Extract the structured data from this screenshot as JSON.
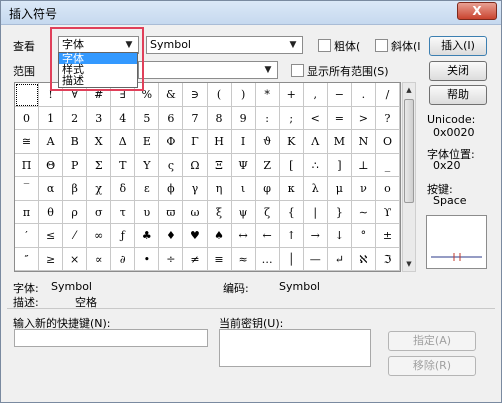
{
  "window": {
    "title": "插入符号",
    "close_label": "X"
  },
  "view": {
    "label": "查看",
    "combo_value": "字体",
    "dropdown_options": [
      "字体",
      "样式",
      "描述"
    ],
    "font_value": "Symbol"
  },
  "options": {
    "bold_label": "粗体(",
    "italic_label": "斜体(I",
    "range_label": "范围",
    "show_all_label": "显示所有范围(S)"
  },
  "buttons": {
    "insert": "插入(I)",
    "close": "关闭",
    "help": "帮助",
    "assign": "指定(A)",
    "remove": "移除(R)"
  },
  "info": {
    "unicode_label": "Unicode:",
    "unicode_value": "0x0020",
    "font_pos_label": "字体位置:",
    "font_pos_value": "0x20",
    "key_label": "按键:",
    "key_value": "Space"
  },
  "status": {
    "font_label": "字体:",
    "font_value": "Symbol",
    "code_label": "编码:",
    "code_value": "Symbol",
    "desc_label": "描述:",
    "desc_value": "空格"
  },
  "shortcut": {
    "new_label": "输入新的快捷键(N):",
    "current_label": "当前密钥(U):"
  },
  "symbols": [
    "",
    "!",
    "∀",
    "#",
    "∃",
    "%",
    "&",
    "∋",
    "(",
    ")",
    "*",
    "+",
    ",",
    "−",
    ".",
    "/",
    "0",
    "1",
    "2",
    "3",
    "4",
    "5",
    "6",
    "7",
    "8",
    "9",
    ":",
    ";",
    "<",
    "=",
    ">",
    "?",
    "≅",
    "Α",
    "Β",
    "Χ",
    "Δ",
    "Ε",
    "Φ",
    "Γ",
    "Η",
    "Ι",
    "ϑ",
    "Κ",
    "Λ",
    "Μ",
    "Ν",
    "Ο",
    "Π",
    "Θ",
    "Ρ",
    "Σ",
    "Τ",
    "Υ",
    "ς",
    "Ω",
    "Ξ",
    "Ψ",
    "Ζ",
    "[",
    "∴",
    "]",
    "⊥",
    "_",
    "‾",
    "α",
    "β",
    "χ",
    "δ",
    "ε",
    "ϕ",
    "γ",
    "η",
    "ι",
    "φ",
    "κ",
    "λ",
    "μ",
    "ν",
    "ο",
    "π",
    "θ",
    "ρ",
    "σ",
    "τ",
    "υ",
    "ϖ",
    "ω",
    "ξ",
    "ψ",
    "ζ",
    "{",
    "|",
    "}",
    "∼",
    "ϒ",
    "′",
    "≤",
    "⁄",
    "∞",
    "ƒ",
    "♣",
    "♦",
    "♥",
    "♠",
    "↔",
    "←",
    "↑",
    "→",
    "↓",
    "°",
    "±",
    "″",
    "≥",
    "×",
    "∝",
    "∂",
    "•",
    "÷",
    "≠",
    "≡",
    "≈",
    "…",
    "│",
    "—",
    "↵",
    "ℵ",
    "ℑ"
  ]
}
